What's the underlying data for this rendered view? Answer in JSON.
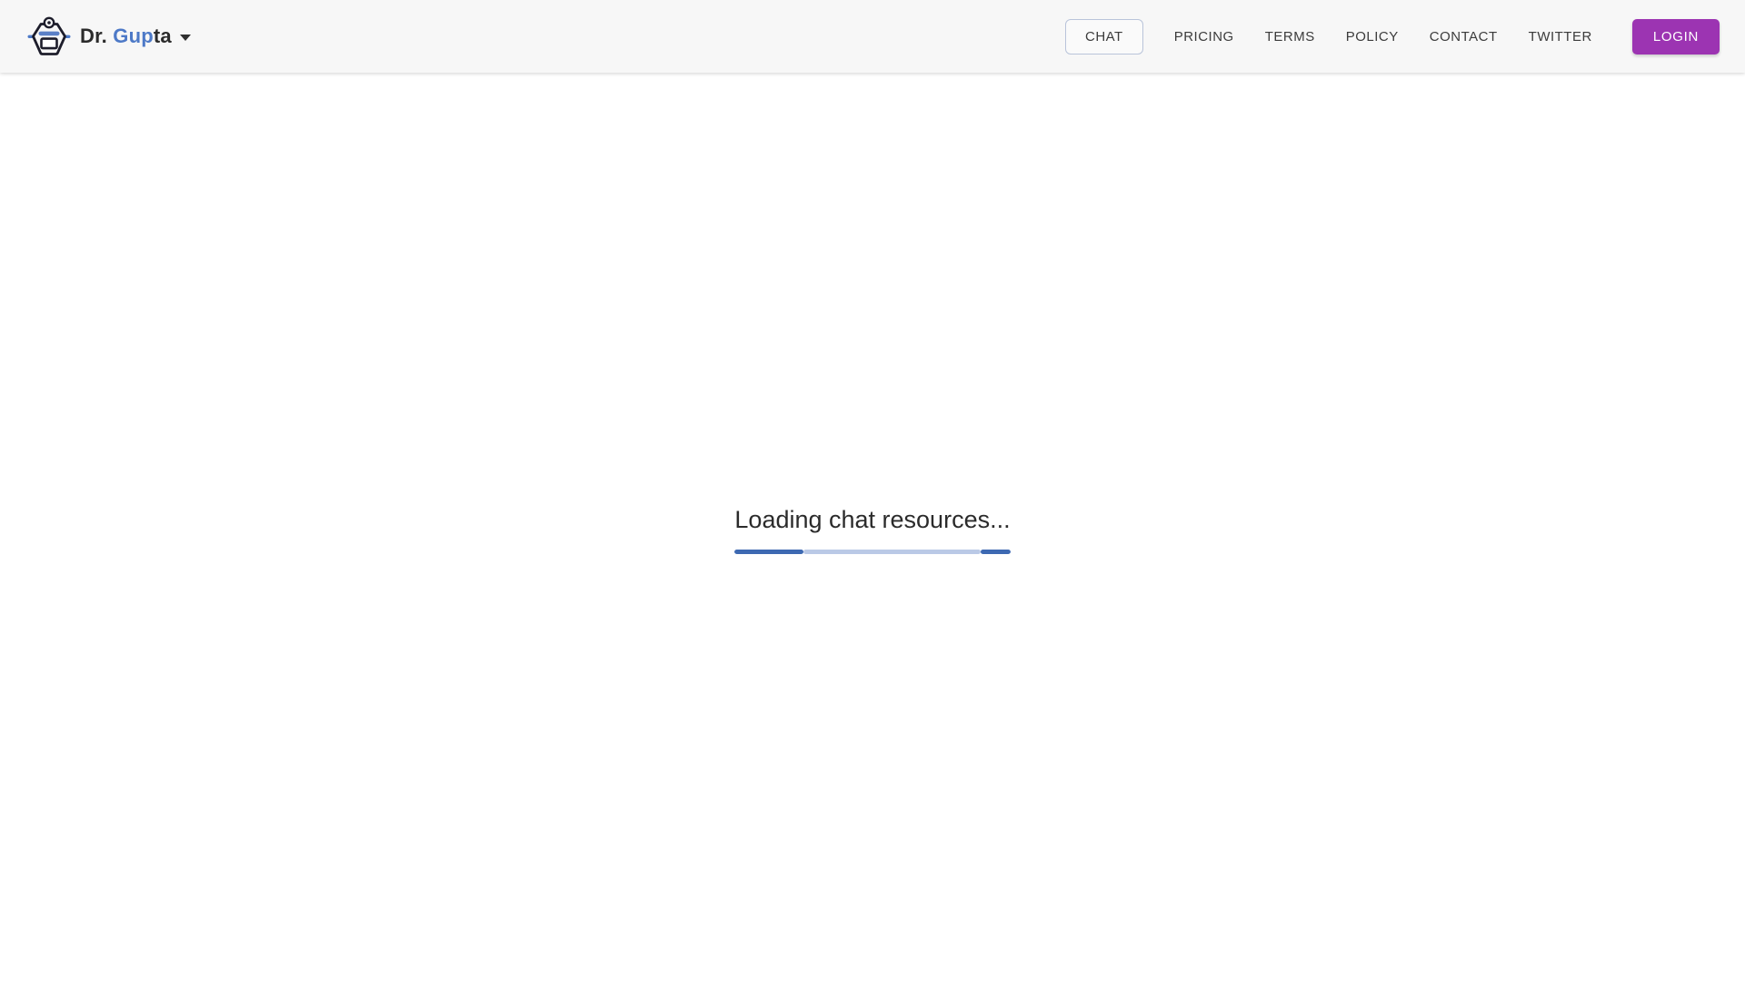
{
  "brand": {
    "name_prefix": "Dr. ",
    "name_highlight": "Gup",
    "name_suffix": "ta",
    "logo_icon": "robot-doctor-icon",
    "dropdown_icon": "caret-down-icon"
  },
  "nav": {
    "items": [
      {
        "label": "CHAT",
        "active": true
      },
      {
        "label": "PRICING",
        "active": false
      },
      {
        "label": "TERMS",
        "active": false
      },
      {
        "label": "POLICY",
        "active": false
      },
      {
        "label": "CONTACT",
        "active": false
      },
      {
        "label": "TWITTER",
        "active": false
      }
    ],
    "login_label": "LOGIN"
  },
  "main": {
    "loading_text": "Loading chat resources...",
    "progress": {
      "primary_percent": 24.8,
      "buffer_percent": 89.3,
      "primary_color": "#3d69b2",
      "buffer_color": "#bac9e6"
    }
  },
  "colors": {
    "header_bg": "#f7f7f7",
    "page_bg": "#ffffff",
    "accent_blue": "#4d79c7",
    "icon_outline": "#1d1d2b",
    "login_purple": "#9c34b2",
    "chat_box_border": "#b9c4da",
    "nav_text": "#3c3c3c",
    "body_text": "#2b2b2b"
  }
}
